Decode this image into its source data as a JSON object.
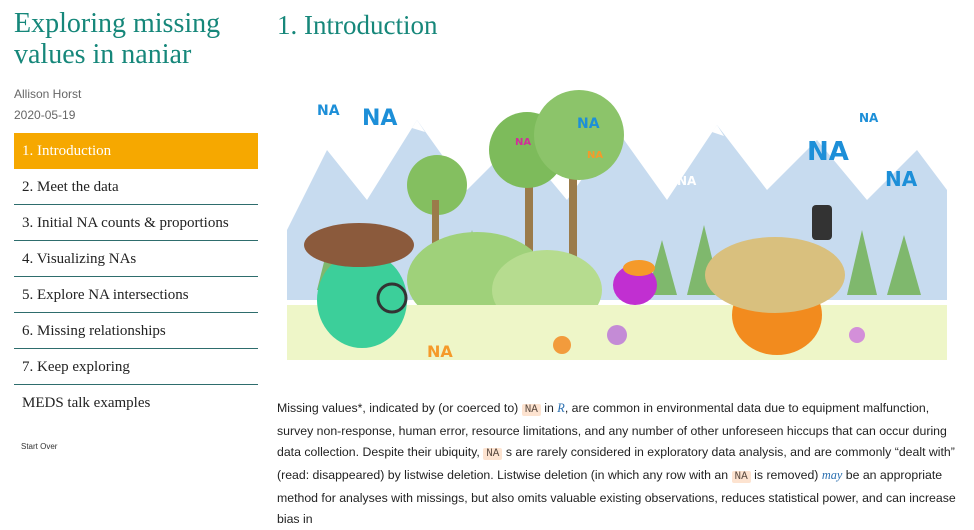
{
  "sidebar": {
    "title": "Exploring missing values in naniar",
    "author": "Allison Horst",
    "date": "2020-05-19",
    "toc": [
      {
        "label": "1. Introduction"
      },
      {
        "label": "2. Meet the data"
      },
      {
        "label": "3. Initial NA counts & proportions"
      },
      {
        "label": "4. Visualizing NAs"
      },
      {
        "label": "5. Explore NA intersections"
      },
      {
        "label": "6. Missing relationships"
      },
      {
        "label": "7. Keep exploring"
      },
      {
        "label": "MEDS talk examples"
      }
    ],
    "start_over": "Start Over"
  },
  "main": {
    "title": "1. Introduction",
    "illustration": {
      "labels": [
        "NA",
        "NA",
        "NA",
        "NA",
        "NA",
        "NA",
        "NA",
        "NA",
        "NA",
        "NA"
      ]
    },
    "paragraph": {
      "t1": "Missing values*, indicated by (or coerced to) ",
      "na1": "NA",
      "t2": " in ",
      "r": "R",
      "t3": ", are common in environmental data due to equipment malfunction, survey non-response, human error, resource limitations, and any number of other unforeseen hiccups that can occur during data collection. Despite their ubiquity, ",
      "na2": "NA",
      "t4": " s are rarely considered in exploratory data analysis, and are commonly “dealt with” (read: disappeared) by listwise deletion. Listwise deletion (in which any row with an ",
      "na3": "NA",
      "t5": " is removed) ",
      "may": "may",
      "t6": " be an appropriate method for analyses with missings, but also omits valuable existing observations, reduces statistical power, and can increase bias in"
    }
  }
}
